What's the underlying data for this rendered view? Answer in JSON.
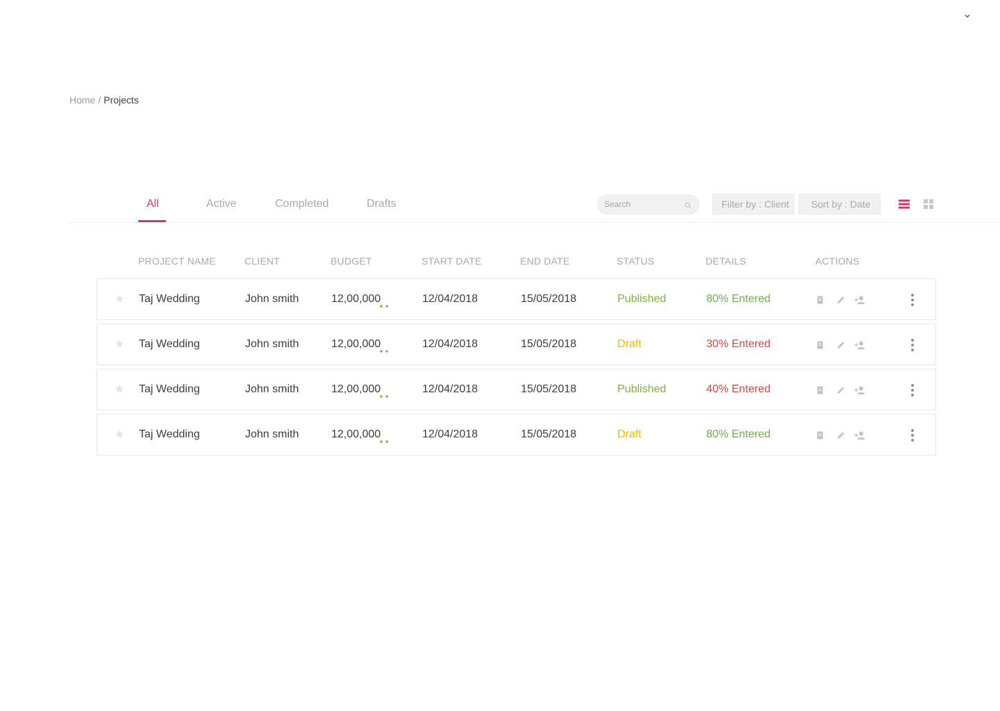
{
  "header": {
    "user_menu_icon": "chevron-down-icon"
  },
  "breadcrumb": {
    "home": "Home",
    "separator": "/",
    "current": "Projects"
  },
  "tabs": [
    {
      "label": "All",
      "active": true
    },
    {
      "label": "Active",
      "active": false
    },
    {
      "label": "Completed",
      "active": false
    },
    {
      "label": "Drafts",
      "active": false
    }
  ],
  "search": {
    "placeholder": "Search",
    "icon": "search-icon"
  },
  "filter": {
    "label": "Filter by : Client"
  },
  "sort": {
    "label": "Sort by : Date"
  },
  "view_toggle": {
    "list_icon": "list-view-icon",
    "grid_icon": "grid-view-icon",
    "active": "list"
  },
  "table": {
    "columns": [
      "PROJECT NAME",
      "CLIENT",
      "BUDGET",
      "START DATE",
      "END DATE",
      "STATUS",
      "DETAILS",
      "ACTIONS"
    ],
    "rows": [
      {
        "project": "Taj Wedding",
        "client": "John smith",
        "budget": "12,00,000",
        "start": "12/04/2018",
        "end": "15/05/2018",
        "status": "Published",
        "details": "80% Entered"
      },
      {
        "project": "Taj Wedding",
        "client": "John smith",
        "budget": "12,00,000",
        "start": "12/04/2018",
        "end": "15/05/2018",
        "status": "Draft",
        "details": "30% Entered"
      },
      {
        "project": "Taj Wedding",
        "client": "John smith",
        "budget": "12,00,000",
        "start": "12/04/2018",
        "end": "15/05/2018",
        "status": "Published",
        "details": "40% Entered"
      },
      {
        "project": "Taj Wedding",
        "client": "John smith",
        "budget": "12,00,000",
        "start": "12/04/2018",
        "end": "15/05/2018",
        "status": "Draft",
        "details": "80% Entered"
      }
    ],
    "row_icons": [
      "star-icon",
      "document-icon",
      "edit-pencil-icon",
      "add-person-icon",
      "more-vertical-icon"
    ]
  },
  "colors": {
    "accent": "#d6336c",
    "published": "#7cb342",
    "draft": "#f5b800",
    "details_high": "#6ab04c",
    "details_low": "#e8403a",
    "muted": "#a9a9a9"
  }
}
